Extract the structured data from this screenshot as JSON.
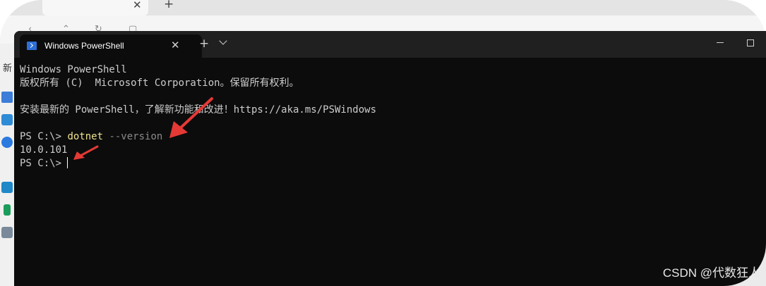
{
  "background_window": {
    "sidebar_label": "新"
  },
  "terminal": {
    "tab_title": "Windows PowerShell",
    "tab_close_glyph": "✕",
    "new_tab_glyph": "+",
    "lines": {
      "l1": "Windows PowerShell",
      "l2": "版权所有 (C)  Microsoft Corporation。保留所有权利。",
      "l3": "安装最新的 PowerShell，了解新功能和改进！https://aka.ms/PSWindows",
      "prompt1": "PS C:\\> ",
      "command": "dotnet",
      "parameter": " --version",
      "output": "10.0.101",
      "prompt2": "PS C:\\>"
    }
  },
  "watermark": "CSDN @代数狂人",
  "colors": {
    "terminal_bg": "#0c0c0c",
    "command": "#f0e28c",
    "parameter": "#8a8a8a",
    "text": "#cccccc",
    "arrow": "#e53935"
  }
}
